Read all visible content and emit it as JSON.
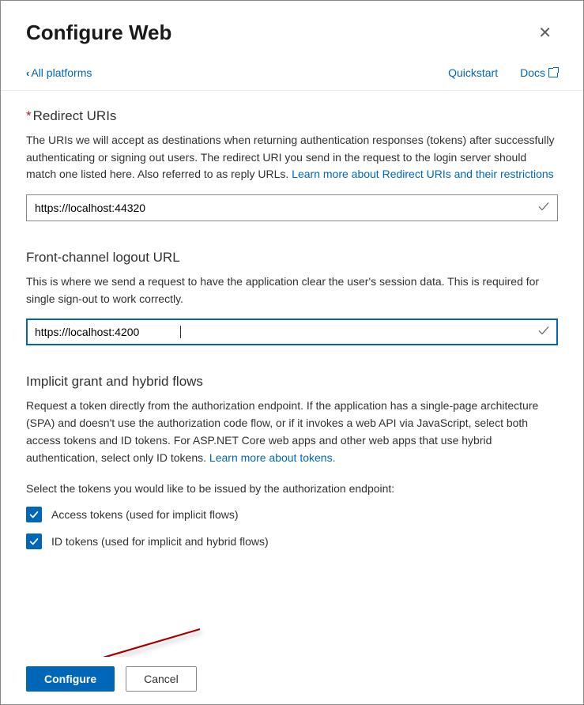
{
  "header": {
    "title": "Configure Web",
    "back_label": "All platforms",
    "quickstart": "Quickstart",
    "docs": "Docs"
  },
  "redirect": {
    "title": "Redirect URIs",
    "desc_prefix": "The URIs we will accept as destinations when returning authentication responses (tokens) after successfully authenticating or signing out users. The redirect URI you send in the request to the login server should match one listed here. Also referred to as reply URLs. ",
    "link": "Learn more about Redirect URIs and their restrictions",
    "value": "https://localhost:44320"
  },
  "logout": {
    "title": "Front-channel logout URL",
    "desc": "This is where we send a request to have the application clear the user's session data. This is required for single sign-out to work correctly.",
    "value": "https://localhost:4200"
  },
  "implicit": {
    "title": "Implicit grant and hybrid flows",
    "desc_prefix": "Request a token directly from the authorization endpoint. If the application has a single-page architecture (SPA) and doesn't use the authorization code flow, or if it invokes a web API via JavaScript, select both access tokens and ID tokens. For ASP.NET Core web apps and other web apps that use hybrid authentication, select only ID tokens. ",
    "link": "Learn more about tokens.",
    "prompt": "Select the tokens you would like to be issued by the authorization endpoint:",
    "access_label": "Access tokens (used for implicit flows)",
    "id_label": "ID tokens (used for implicit and hybrid flows)"
  },
  "footer": {
    "configure": "Configure",
    "cancel": "Cancel"
  }
}
